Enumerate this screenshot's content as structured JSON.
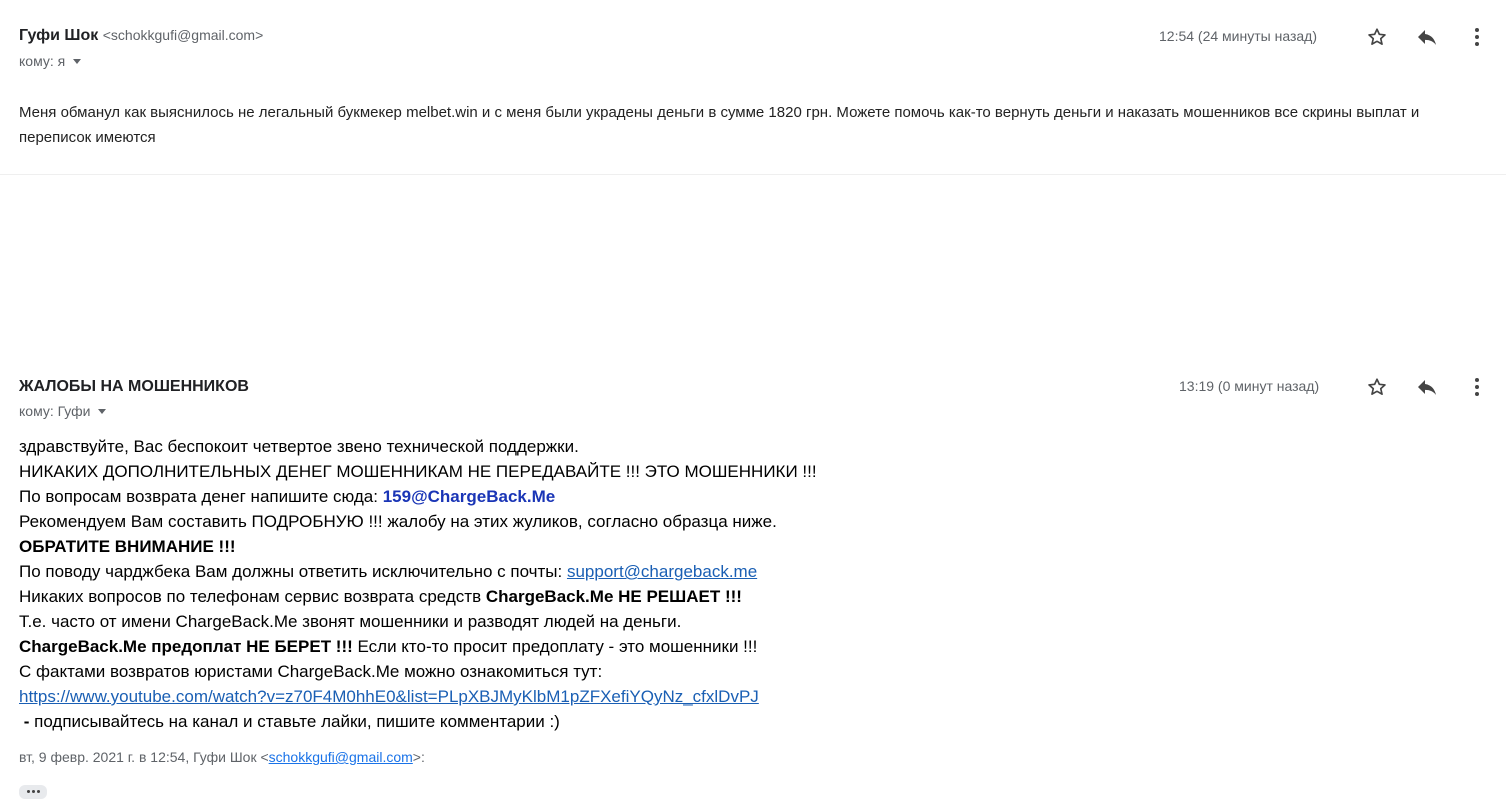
{
  "message1": {
    "sender_name": "Гуфи Шок",
    "sender_email": "<schokkgufi@gmail.com>",
    "to_label": "кому: я",
    "timestamp": "12:54 (24 минуты назад)",
    "body": "Меня обманул  как выяснилось не легальный букмекер melbet.win и с меня были украдены деньги в сумме 1820 грн. Можете помочь как-то вернуть деньги и наказать мошенников все скрины выплат и переписок имеются"
  },
  "message2": {
    "sender_name": "ЖАЛОБЫ НА МОШЕННИКОВ",
    "to_label": "кому: Гуфи",
    "timestamp": "13:19 (0 минут назад)",
    "lines": {
      "l1": "здравствуйте, Вас беспокоит четвертое звено технической поддержки.",
      "l2": "НИКАКИХ ДОПОЛНИТЕЛЬНЫХ ДЕНЕГ МОШЕННИКАМ НЕ ПЕРЕДАВАЙТЕ !!! ЭТО МОШЕННИКИ !!!",
      "l3_text": "По вопросам возврата денег напишите сюда: ",
      "l3_email": "159@ChargeBack.Me",
      "l4": "Рекомендуем Вам составить ПОДРОБНУЮ !!! жалобу на этих жуликов, согласно образца ниже.",
      "l5": "ОБРАТИТЕ ВНИМАНИЕ !!!",
      "l6_text": "По поводу чарджбека Вам должны ответить исключительно с почты: ",
      "l6_link": "support@chargeback.me",
      "l7_text": "Никаких вопросов по телефонам сервис возврата средств ",
      "l7_bold": "ChargeBack.Me НЕ РЕШАЕТ !!!",
      "l8": "Т.е. часто от имени ChargeBack.Me звонят мошенники и разводят людей на деньги.",
      "l9_bold": "ChargeBack.Me предоплат НЕ БЕРЕТ !!!",
      "l9_text": " Если кто-то просит предоплату - это мошенники !!!",
      "l10": "С фактами возвратов юристами ChargeBack.Me можно ознакомиться тут:",
      "l11_link": "https://www.youtube.com/watch?v=z70F4M0hhE0&list=PLpXBJMyKlbM1pZFXefiYQyNz_cfxlDvPJ",
      "l12_bold": " - ",
      "l12_text": "подписывайтесь на канал и ставьте лайки, пишите комментарии :)"
    },
    "quote_prefix": "вт, 9 февр. 2021 г. в 12:54, Гуфи Шок <",
    "quote_email": "schokkgufi@gmail.com",
    "quote_suffix": ">:"
  },
  "icons": [
    "star-icon",
    "reply-icon",
    "more-vert-icon",
    "chevron-down-icon",
    "ellipsis-icon"
  ],
  "colors": {
    "link": "#1a5fb4",
    "email_highlight": "#1a35b6",
    "secondary_text": "#5f6368"
  }
}
